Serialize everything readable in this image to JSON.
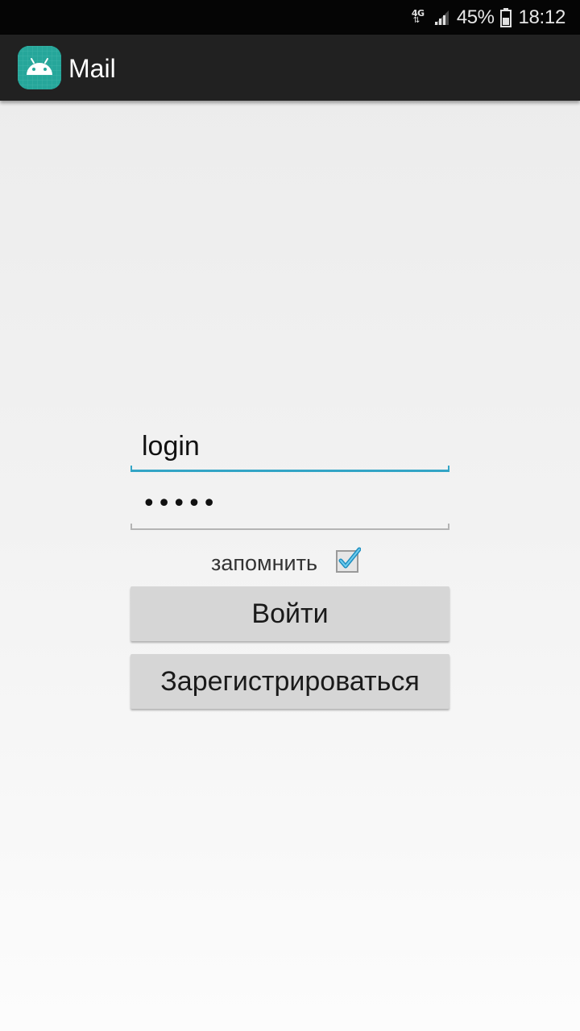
{
  "status_bar": {
    "network_type": "4G",
    "network_arrows": "⇅",
    "battery_percent": "45%",
    "time": "18:12"
  },
  "action_bar": {
    "app_icon": "android-icon",
    "title": "Mail"
  },
  "login_form": {
    "login_field": {
      "value": "login"
    },
    "password_field": {
      "value": "•••••"
    },
    "remember_label": "запомнить",
    "remember_checked": true,
    "login_button_label": "Войти",
    "register_button_label": "Зарегистрироваться"
  },
  "colors": {
    "accent": "#33a5c6",
    "app_icon_bg": "#26a69a",
    "action_bar_bg": "#212121",
    "status_bar_bg": "#050505",
    "button_bg": "#d6d6d6"
  }
}
